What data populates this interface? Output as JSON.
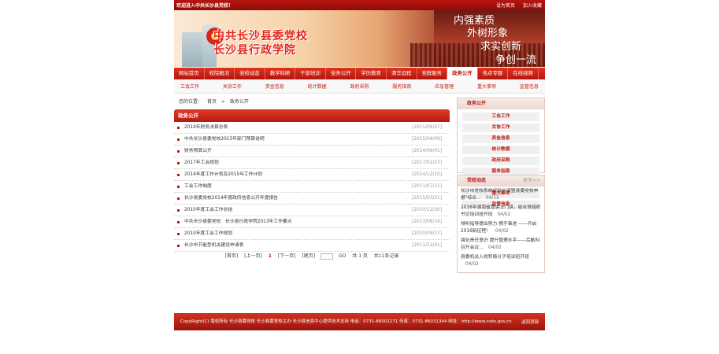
{
  "topbar": {
    "welcome": "欢迎进入中共长沙县党校！",
    "set_home": "设为首页",
    "add_fav": "加入收藏"
  },
  "banner": {
    "title_line1": "中共长沙县委党校",
    "title_line2": "长沙县行政学院",
    "slogans": [
      "内强素质",
      "外树形象",
      "求实创新",
      "争创一流"
    ]
  },
  "nav": [
    "网站首页",
    "校院概况",
    "党校动态",
    "教学科研",
    "干部培训",
    "党务公开",
    "学历教育",
    "清华远程",
    "党群服务",
    "政务公开",
    "热点专题",
    "在线视频"
  ],
  "nav_active_index": 9,
  "subnav": [
    "工会工作",
    "关协工作",
    "资金信息",
    "统计数据",
    "政府采购",
    "服务指南",
    "应急管理",
    "重大事项",
    "监管信息"
  ],
  "breadcrumb": {
    "label": "您的位置：",
    "home": "首页",
    "sep": ">",
    "current": "政务公开"
  },
  "main": {
    "title": "政务公开",
    "items": [
      {
        "title": "2014年财务决算总表",
        "date": "[2015/06/07]"
      },
      {
        "title": "中共长沙县委党校2015年部门预算说明",
        "date": "[2015/06/09]"
      },
      {
        "title": "财务预算公开",
        "date": "[2014/06/01]"
      },
      {
        "title": "2017年工会规划",
        "date": "[2017/02/23]"
      },
      {
        "title": "2014年度工作计划及2015年工作计划",
        "date": "[2014/12/10]"
      },
      {
        "title": "工会工作制度",
        "date": "[2011/07/11]"
      },
      {
        "title": "长沙县委党校2014年度政府信息公开年度报告",
        "date": "[2015/03/21]"
      },
      {
        "title": "2010年度工会工作总结",
        "date": "[2010/12/30]"
      },
      {
        "title": "中共长沙县委党校　长沙县行政学院2013年工作要点",
        "date": "[2013/06/14]"
      },
      {
        "title": "2010年度工会工作规划",
        "date": "[2010/09/17]"
      },
      {
        "title": "长沙市节能型机关建设申请表",
        "date": "[2011/12/01]"
      }
    ]
  },
  "pager": {
    "first": "[首页]",
    "prev": "[上一页]",
    "current": "1",
    "next": "[下一页]",
    "last": "[尾页]",
    "go": "GO",
    "total_pages": "共 1 页",
    "total_records": "共11条记录"
  },
  "side_gov": {
    "title": "政务公开",
    "items": [
      "工会工作",
      "关协工作",
      "资金信息",
      "统计数据",
      "政府采购",
      "服务指南",
      "应急管理",
      "重大事项",
      "监管信息"
    ]
  },
  "side_news": {
    "title": "党校动态",
    "more": "更多>>",
    "items": [
      {
        "title": "长沙市党校系统经验交流暨县委党校申报\"综合…",
        "date": "04/13"
      },
      {
        "title": "2016年湖南省宣讲上门讲，结合党组织书记培训班开班",
        "date": "04/02"
      },
      {
        "title": "倾听指导提出努力 携手奋进 ——开启2016新征程！",
        "date": "04/02"
      },
      {
        "title": "强化责任意识 提升管理水平——后勤科召开会议…",
        "date": "04/02"
      },
      {
        "title": "县委机关入党积极分子培训班开班",
        "date": "04/02"
      }
    ]
  },
  "footer": {
    "text": "CopyRight(C) 版权所有 长沙县委党校 长沙县委党校主办 长沙县信息中心提供技术支持 电话：0731-86002271 传真：0731-86031344 网址：http://www.csdx.gov.cn",
    "back_top": "返回顶部"
  }
}
